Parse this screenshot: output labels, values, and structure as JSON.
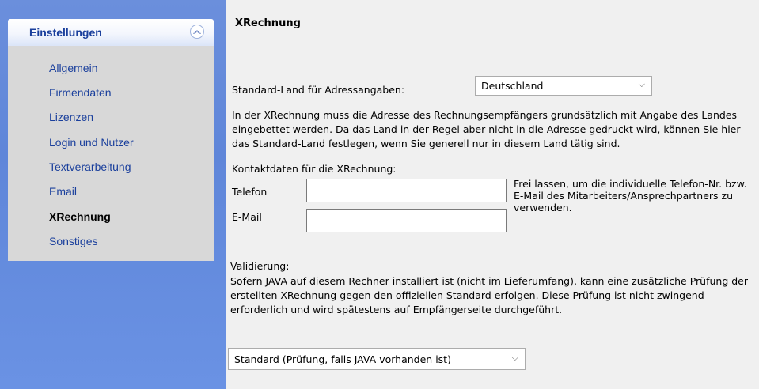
{
  "sidebar": {
    "title": "Einstellungen",
    "collapse_icon": "︽",
    "items": [
      {
        "label": "Allgemein",
        "active": false
      },
      {
        "label": "Firmendaten",
        "active": false
      },
      {
        "label": "Lizenzen",
        "active": false
      },
      {
        "label": "Login und Nutzer",
        "active": false
      },
      {
        "label": "Textverarbeitung",
        "active": false
      },
      {
        "label": "Email",
        "active": false
      },
      {
        "label": "XRechnung",
        "active": true
      },
      {
        "label": "Sonstiges",
        "active": false
      }
    ]
  },
  "main": {
    "title": "XRechnung",
    "country": {
      "label": "Standard-Land für Adressangaben:",
      "value": "Deutschland",
      "description": "In der XRechnung muss die Adresse des Rechnungsempfängers grundsätzlich mit Angabe des Landes eingebettet werden. Da das Land in der Regel aber nicht in die Adresse gedruckt wird, können Sie hier das Standard-Land festlegen, wenn Sie generell nur in diesem Land tätig sind."
    },
    "contact": {
      "heading": "Kontaktdaten für die XRechnung:",
      "phone_label": "Telefon",
      "phone_value": "",
      "email_label": "E-Mail",
      "email_value": "",
      "hint": "Frei lassen, um die individuelle Telefon-Nr. bzw. E-Mail des Mitarbeiters/Ansprechpartners zu verwenden."
    },
    "validation": {
      "heading": "Validierung:",
      "description": "Sofern JAVA auf diesem Rechner installiert ist (nicht im Lieferumfang), kann eine zusätzliche Prüfung der erstellten XRechnung gegen den offiziellen Standard erfolgen. Diese Prüfung ist nicht zwingend erforderlich und wird spätestens auf Empfängerseite durchgeführt.",
      "mode_value": "Standard (Prüfung, falls JAVA vorhanden ist)"
    },
    "chevron_icon": "⌵"
  },
  "colors": {
    "sidebar_bg": "#6b8fdc",
    "nav_link": "#1a3f9c",
    "panel_body": "#d8d8d8",
    "main_bg": "#f0f0f0"
  }
}
